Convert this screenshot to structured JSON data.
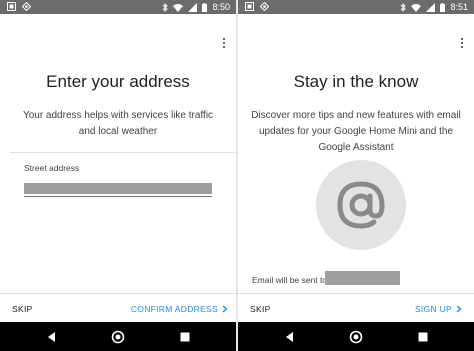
{
  "left_screen": {
    "status_time": "8:50",
    "title": "Enter your address",
    "subtitle_lines": [
      "Your address helps with services like traffic",
      "and local weather"
    ],
    "field_label": "Street address",
    "skip_label": "SKIP",
    "action_label": "CONFIRM ADDRESS"
  },
  "right_screen": {
    "status_time": "8:51",
    "title": "Stay in the know",
    "subtitle_lines": [
      "Discover more tips and new features with email",
      "updates for your Google Home Mini and the",
      "Google Assistant"
    ],
    "email_prefix": "Email will be sent to",
    "skip_label": "SKIP",
    "action_label": "SIGN UP"
  },
  "colors": {
    "accent": "#1e88e5",
    "statusbar": "#6b6b6b",
    "navbar": "#000000",
    "redaction": "#9e9e9e"
  },
  "icons": {
    "status_left": [
      "notification-square-icon",
      "diamond-icon"
    ],
    "status_right": [
      "bluetooth-icon",
      "wifi-icon",
      "signal-icon",
      "battery-icon"
    ],
    "nav": [
      "back-icon",
      "home-icon",
      "recents-icon"
    ],
    "right_hero": "at-sign-icon",
    "action_chevron": "chevron-right-icon"
  }
}
